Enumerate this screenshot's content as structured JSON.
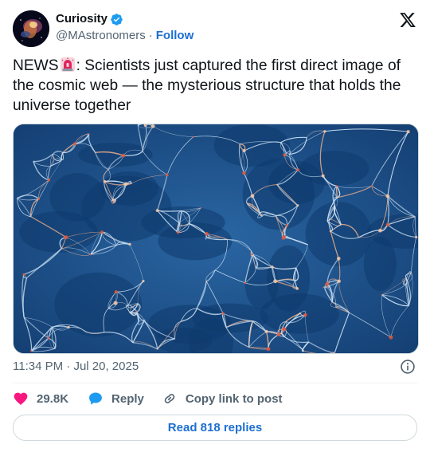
{
  "author": {
    "name": "Curiosity",
    "handle": "@MAstronomers",
    "separator": "·",
    "follow_label": "Follow",
    "verified_color": "#1d9bf0",
    "avatar_icon": "nebula-avatar"
  },
  "tweet": {
    "text_before_emoji": "NEWS",
    "emoji": "rotating-light-icon",
    "text_after_emoji": ": Scientists just captured the first direct image of the cosmic web — the mysterious structure that holds the universe together"
  },
  "media": {
    "icon": "cosmic-web-image"
  },
  "meta": {
    "time": "11:34 PM",
    "separator": "·",
    "date": "Jul 20, 2025"
  },
  "actions": {
    "likes": "29.8K",
    "reply_label": "Reply",
    "copy_label": "Copy link to post"
  },
  "replies_button": "Read 818 replies",
  "colors": {
    "like": "#f91880",
    "reply": "#1d9bf0",
    "link": "#1d6fd1",
    "muted": "#536471"
  }
}
